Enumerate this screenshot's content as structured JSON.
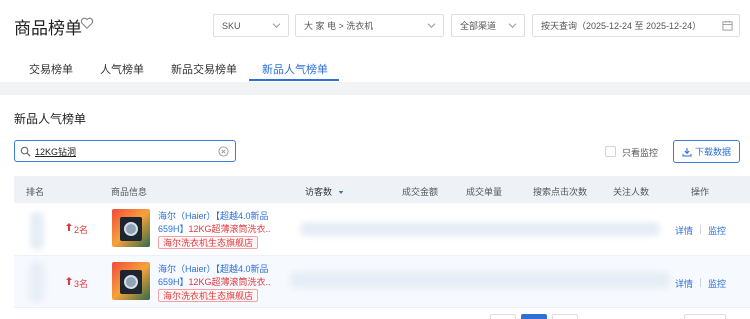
{
  "page": {
    "title": "商品榜单"
  },
  "filters": {
    "sku": "SKU",
    "category": "大 家 电 > 洗衣机",
    "channel": "全部渠道",
    "date": "按天查询（2025-12-24 至 2025-12-24）"
  },
  "tabs": [
    {
      "label": "交易榜单"
    },
    {
      "label": "人气榜单"
    },
    {
      "label": "新品交易榜单"
    },
    {
      "label": "新品人气榜单",
      "active": true
    }
  ],
  "section": {
    "title": "新品人气榜单",
    "search_value": "12KG钻洞",
    "monitor_label": "只看监控",
    "download_label": "下载数据"
  },
  "table": {
    "headers": [
      "排名",
      "商品信息",
      "访客数",
      "成交金额",
      "成交单量",
      "搜索点击次数",
      "关注人数",
      "操作"
    ],
    "rows": [
      {
        "rank": "2名",
        "name_line1": "海尔（Haier）【超越4.0新品",
        "name_line2_prefix": "659H】",
        "name_line2_red": "12KG超薄滚筒洗衣..",
        "shop": "海尔洗衣机生态旗舰店",
        "action_detail": "详情",
        "action_monitor": "监控"
      },
      {
        "rank": "3名",
        "name_line1": "海尔（Haier）【超越4.0新品",
        "name_line2_prefix": "659H】",
        "name_line2_red": "12KG超薄滚筒洗衣..",
        "shop": "海尔洗衣机生态旗舰店",
        "action_detail": "详情",
        "action_monitor": "监控"
      }
    ]
  },
  "colors": {
    "accent": "#2e6fd8",
    "rank_red": "#e0383e"
  }
}
